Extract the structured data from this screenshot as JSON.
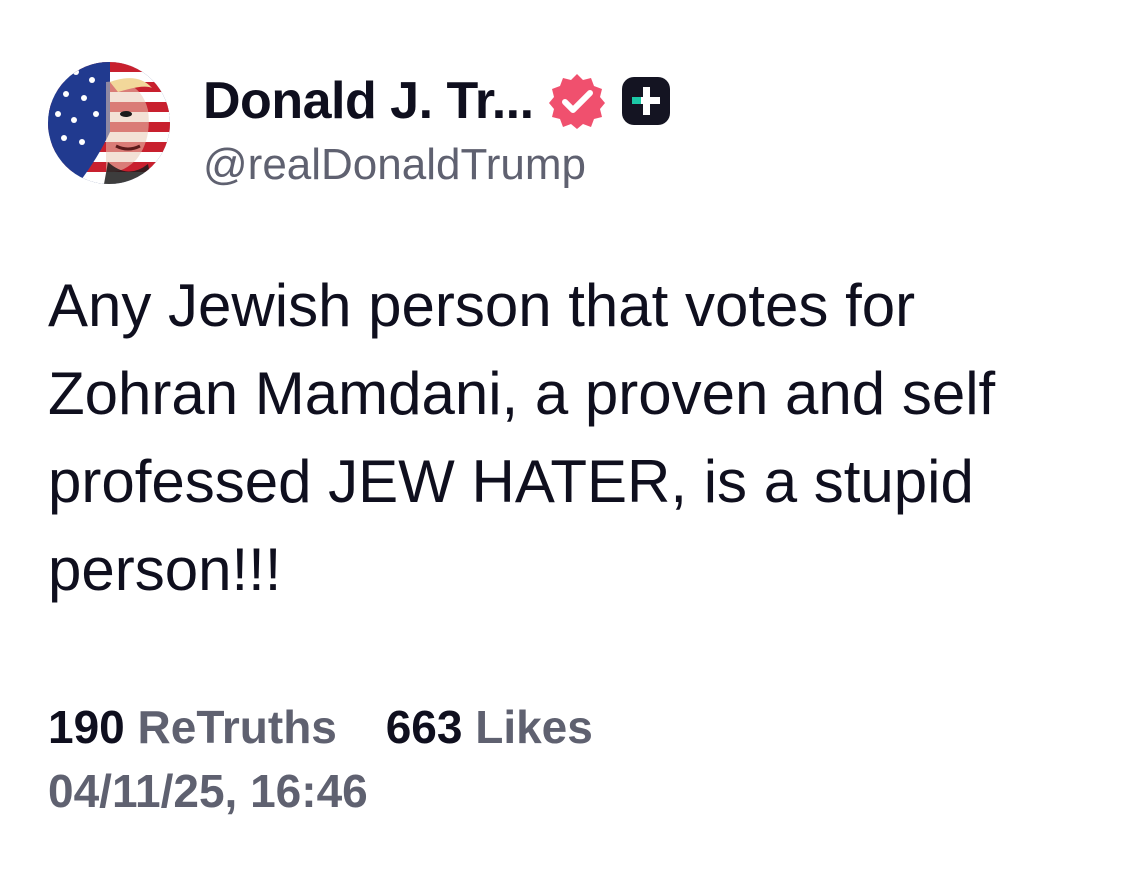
{
  "author": {
    "display_name": "Donald J. Tr...",
    "handle": "@realDonaldTrump",
    "avatar": "flag-portrait-avatar",
    "verified_icon": "verified-check-badge-icon",
    "plus_icon": "truth-plus-badge-icon",
    "verified_color": "#f0506e",
    "plus_color": "#141422",
    "plus_accent": "#1cc8a6"
  },
  "post": {
    "text": "Any Jewish person that votes for Zohran Mamdani, a proven and self professed JEW HATER, is a stupid person!!!"
  },
  "stats": {
    "retruths_count": "190",
    "retruths_label": "ReTruths",
    "likes_count": "663",
    "likes_label": "Likes"
  },
  "timestamp": "04/11/25, 16:46",
  "colors": {
    "text_primary": "#0f0f1e",
    "text_secondary": "#5f6170",
    "background": "#ffffff"
  }
}
